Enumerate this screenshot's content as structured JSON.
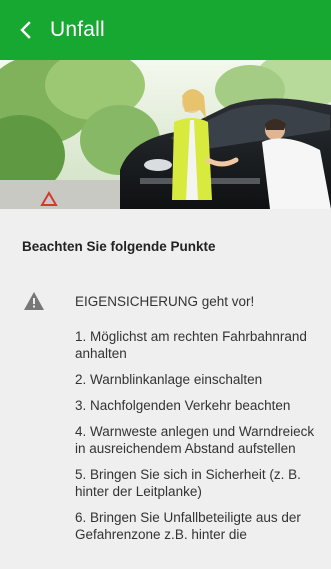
{
  "header": {
    "title": "Unfall"
  },
  "colors": {
    "appbar": "#17a832",
    "background": "#efefef",
    "warning_icon": "#777777"
  },
  "content": {
    "section_title": "Beachten Sie folgende Punkte",
    "warning": "EIGENSICHERUNG geht vor!",
    "steps": [
      "1. Möglichst am rechten Fahrbahnrand anhalten",
      "2. Warnblinkanlage einschalten",
      "3. Nachfolgenden Verkehr beachten",
      "4. Warnweste anlegen und Warndreieck in ausreichendem Abstand aufstellen",
      "5. Bringen Sie sich in Sicherheit (z. B. hinter der Leitplanke)",
      "6. Bringen Sie Unfallbeteiligte aus der Gefahrenzone z.B. hinter die"
    ]
  },
  "icons": {
    "back": "chevron-left-icon",
    "warning": "warning-triangle-icon"
  }
}
